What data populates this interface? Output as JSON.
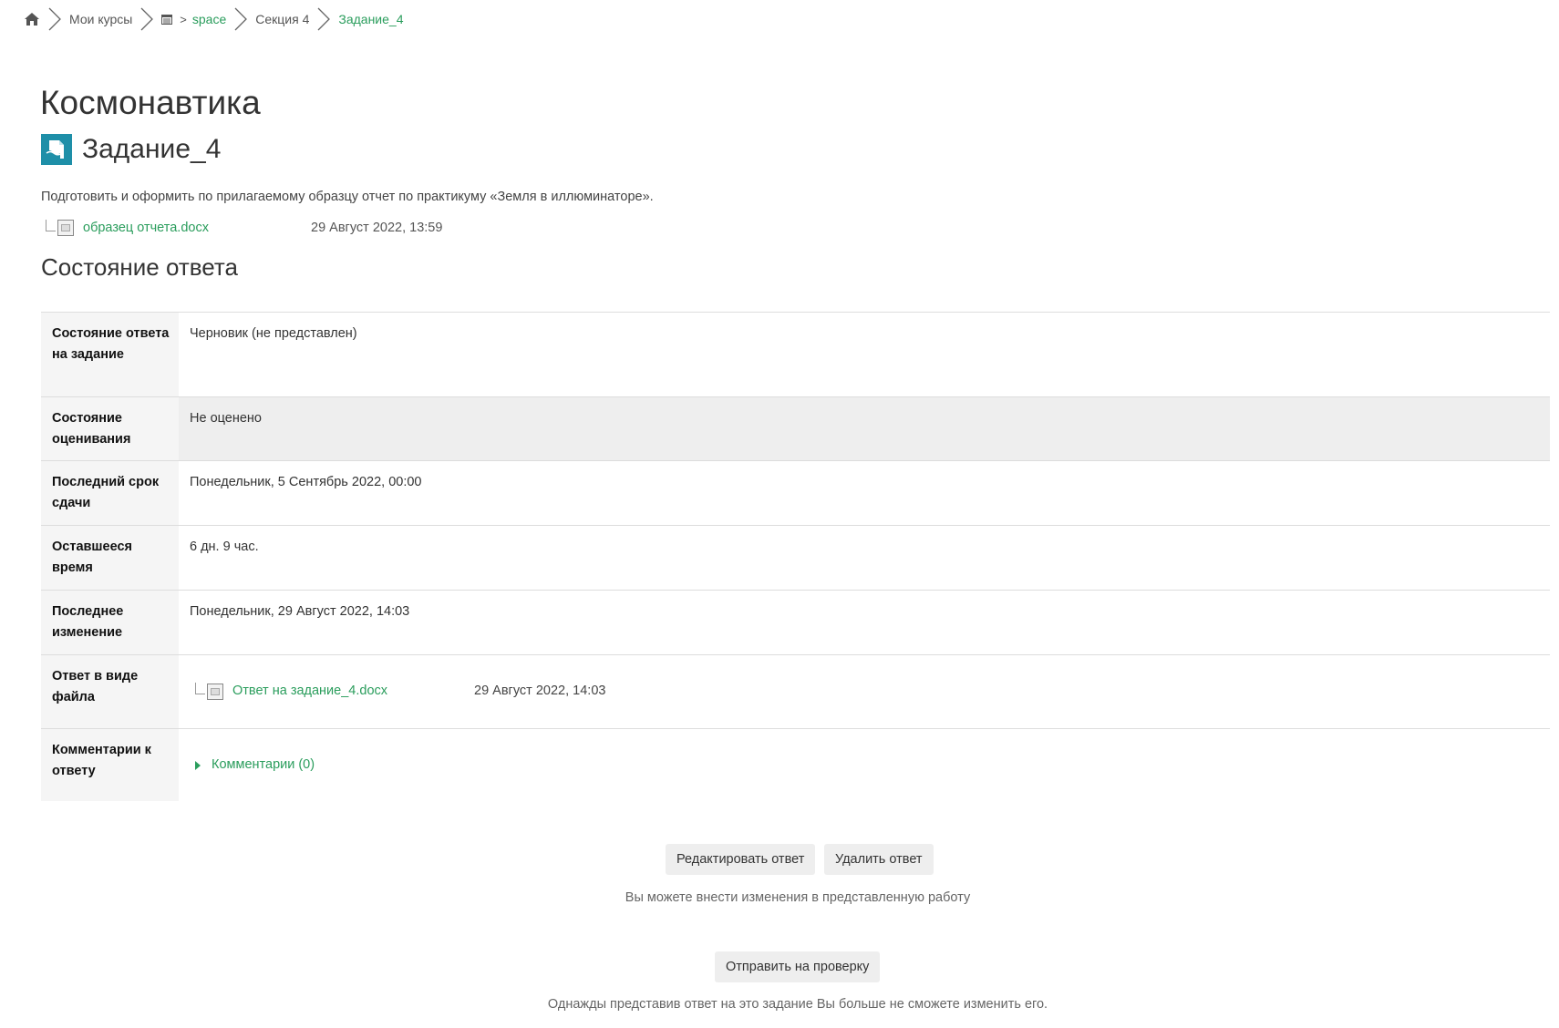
{
  "breadcrumb": {
    "home_icon": "home-icon",
    "my_courses": "Мои курсы",
    "course_icon": "course-index-icon",
    "course": "space",
    "section": "Секция 4",
    "current": "Задание_4"
  },
  "page": {
    "course_title": "Космонавтика",
    "activity_title": "Задание_4",
    "activity_icon": "assignment-icon",
    "intro": "Подготовить и оформить по прилагаемому образцу отчет по практикуму «Земля в иллюминаторе».",
    "attachment": {
      "name": "образец отчета.docx",
      "date": "29 Август 2022, 13:59"
    },
    "section_title": "Состояние ответа"
  },
  "status": {
    "submission_label": "Состояние ответа на задание",
    "submission_value": "Черновик (не представлен)",
    "grading_label": "Состояние оценивания",
    "grading_value": "Не оценено",
    "due_label": "Последний срок сдачи",
    "due_value": "Понедельник, 5 Сентябрь 2022, 00:00",
    "remaining_label": "Оставшееся время",
    "remaining_value": "6 дн. 9 час.",
    "modified_label": "Последнее изменение",
    "modified_value": "Понедельник, 29 Август 2022, 14:03",
    "file_label": "Ответ в виде файла",
    "file_name": "Ответ на задание_4.docx",
    "file_date": "29 Август 2022, 14:03",
    "comments_label": "Комментарии к ответу",
    "comments_link": "Комментарии (0)"
  },
  "actions": {
    "edit_label": "Редактировать ответ",
    "delete_label": "Удалить ответ",
    "edit_hint": "Вы можете внести изменения в представленную работу",
    "submit_label": "Отправить на проверку",
    "submit_hint": "Однажды представив ответ на это задание Вы больше не сможете изменить его."
  },
  "colors": {
    "link": "#2a9d5c",
    "table_header_bg": "#f5f5f5",
    "button_bg": "#eeeeee",
    "activity_icon_bg": "#1e8fa8"
  }
}
